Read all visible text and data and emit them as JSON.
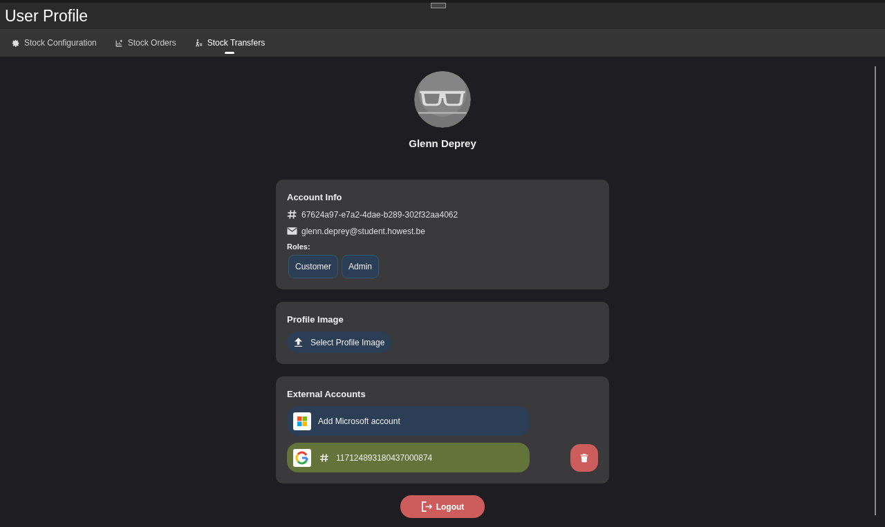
{
  "window": {
    "title": "User Profile"
  },
  "tabs": [
    {
      "label": "Stock Configuration",
      "selected": false
    },
    {
      "label": "Stock Orders",
      "selected": false
    },
    {
      "label": "Stock Transfers",
      "selected": true
    }
  ],
  "profile": {
    "name": "Glenn Deprey"
  },
  "account_info": {
    "title": "Account Info",
    "id": "67624a97-e7a2-4dae-b289-302f32aa4062",
    "email": "glenn.deprey@student.howest.be",
    "roles_label": "Roles:",
    "roles": [
      "Customer",
      "Admin"
    ]
  },
  "profile_image": {
    "title": "Profile Image",
    "button": "Select Profile Image"
  },
  "external_accounts": {
    "title": "External Accounts",
    "items": [
      {
        "kind": "add",
        "label": "Add Microsoft account"
      },
      {
        "kind": "linked",
        "label": "117124893180437000874"
      }
    ]
  },
  "logout": "Logout"
}
